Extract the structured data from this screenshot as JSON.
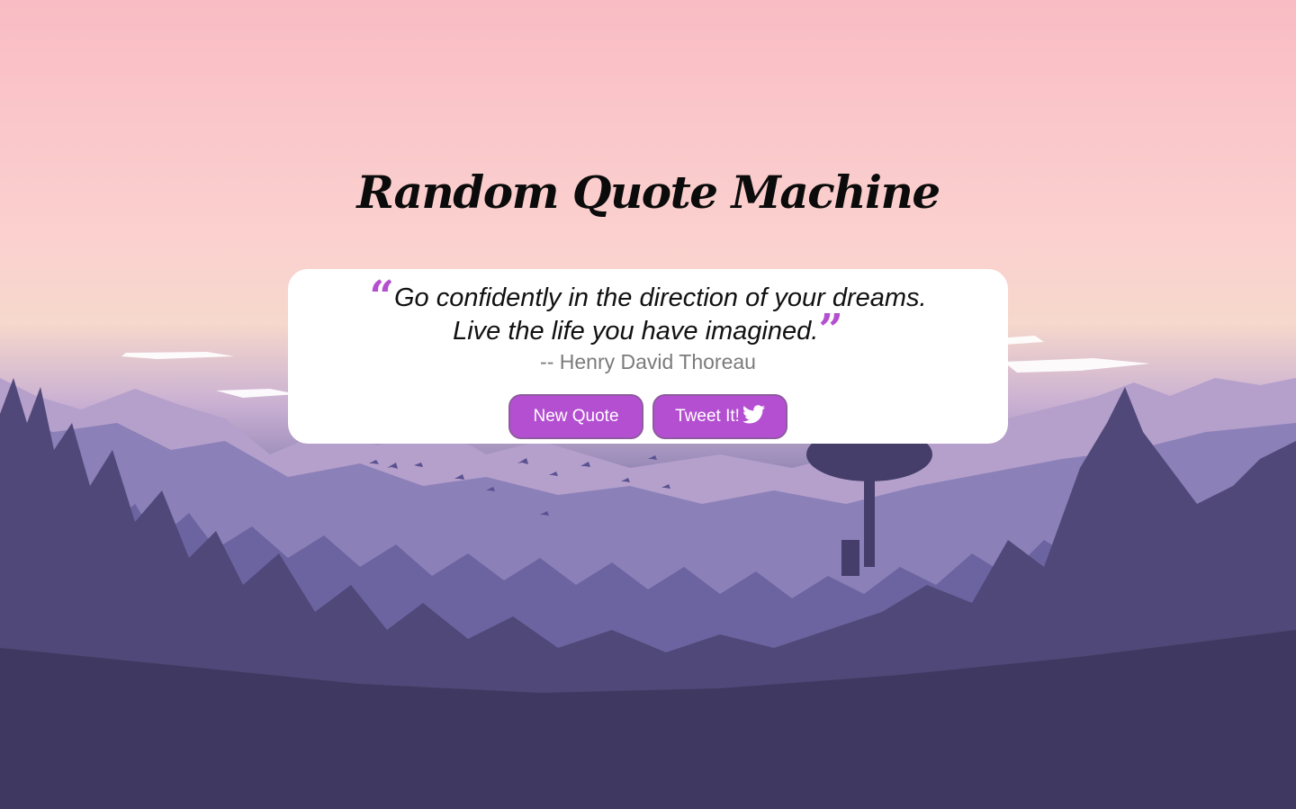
{
  "header": {
    "title": "Random Quote Machine"
  },
  "quote": {
    "open_mark": "“",
    "line1": "Go confidently in the direction of your dreams.",
    "line2": "Live the life you have imagined.",
    "close_mark": "”",
    "author": "-- Henry David Thoreau"
  },
  "actions": {
    "new_quote_label": "New Quote",
    "tweet_label": "Tweet It!",
    "tweet_icon": "twitter-bird-icon"
  },
  "colors": {
    "accent": "#b44fd1",
    "card_bg": "#ffffff",
    "author_text": "#7b7b7b"
  }
}
